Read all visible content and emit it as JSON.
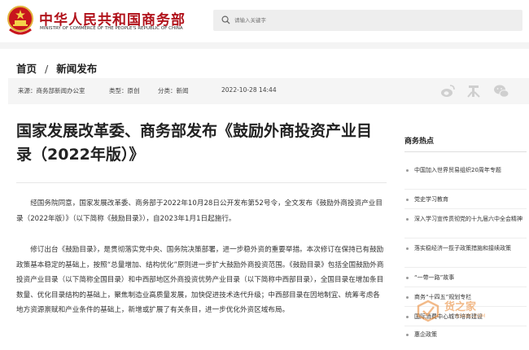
{
  "header": {
    "site_name": "中华人民共和国商务部",
    "site_name_en": "MINISTRY OF COMMERCE OF THE PEOPLE'S REPUBLIC OF CHINA",
    "search_placeholder": "请输入关键字"
  },
  "breadcrumb": {
    "home": "首页",
    "separator": "/",
    "section": "新闻发布"
  },
  "meta": {
    "source": "来源：商务部新闻办公室",
    "type": "类型：原创",
    "category": "分类：新闻",
    "date": "2022-10-28 14:44"
  },
  "article": {
    "title": "国家发展改革委、商务部发布《鼓励外商投资产业目录（2022年版）》",
    "paragraphs": [
      "经国务院同意，国家发展改革委、商务部于2022年10月28日公开发布第52号令，全文发布《鼓励外商投资产业目录（2022年版）》（以下简称《鼓励目录》），自2023年1月1日起施行。",
      "修订出台《鼓励目录》，是贯彻落实党中央、国务院决策部署，进一步稳外资的重要举措。本次修订在保持已有鼓励政策基本稳定的基础上，按照“总量增加、结构优化”原则进一步扩大鼓励外商投资范围。《鼓励目录》包括全国鼓励外商投资产业目录（以下简称全国目录）和中西部地区外商投资优势产业目录（以下简称中西部目录），全国目录在增加条目数量、优化目录结构的基础上，聚焦制造业高质量发展，加快促进技术迭代升级；中西部目录在因地制宜、统筹考虑各地方资源禀赋和产业条件的基础上，新增或扩展了有关条目，进一步优化外资区域布局。"
    ]
  },
  "sidebar": {
    "title": "商务热点",
    "items": [
      "中国加入世界贸易组织20周年专题",
      "党史学习教育",
      "深入学习宣传贯彻党的十九届六中全会精神",
      "落实稳经济一揽子政策措施和接续政策",
      "“一带一路”故事",
      "商务“十四五”规划专栏",
      "国际消费中心城市培育建设",
      "惠企政策"
    ]
  },
  "watermark": {
    "text": "货之家",
    "url": "51HZC.COM"
  },
  "colors": {
    "brand_red": "#b1121b",
    "watermark_orange": "#e8822a"
  }
}
